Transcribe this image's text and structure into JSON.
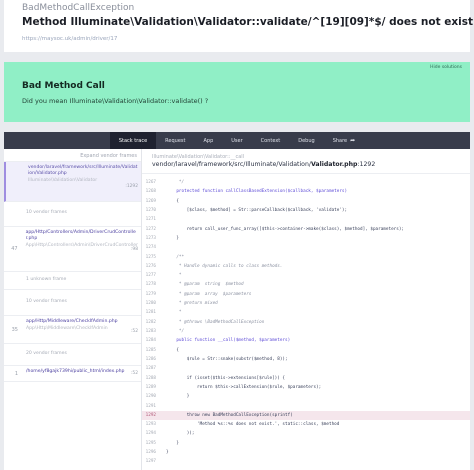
{
  "header": {
    "exception_class": "BadMethodCallException",
    "message": "Method Illuminate\\Validation\\Validator::validate/^[19][09]*$/ does not exist.",
    "url": "https://maysoc.uk/admin/driver/17"
  },
  "solution": {
    "hide_label": "Hide solutions",
    "title": "Bad Method Call",
    "description": "Did you mean Illuminate\\Validation\\Validator::validate() ?"
  },
  "tabs": [
    {
      "label": "Stack trace"
    },
    {
      "label": "Request"
    },
    {
      "label": "App"
    },
    {
      "label": "User"
    },
    {
      "label": "Context"
    },
    {
      "label": "Debug"
    },
    {
      "label": "Share"
    }
  ],
  "stack": {
    "expand_label": "Expand vendor frames",
    "frames": [
      {
        "num": "",
        "file": "vendor/laravel/framework/src/Illuminate/Validation/Validator.php",
        "method": "",
        "line": ""
      },
      {
        "num": "61",
        "file": "Illuminate\\Validation\\Validator",
        "method": "",
        "line": ":1292"
      },
      {
        "num": "",
        "file": "10 vendor frames",
        "method": "",
        "line": ""
      },
      {
        "num": "",
        "file": "app/Http/Controllers/Admin/DriverCrudController.php",
        "method": "",
        "line": ""
      },
      {
        "num": "47",
        "file": "App\\Http\\Controllers\\Admin\\DriverCrudController",
        "method": "",
        "line": ":98"
      },
      {
        "num": "",
        "file": "1 unknown frame",
        "method": "",
        "line": ""
      },
      {
        "num": "",
        "file": "10 vendor frames",
        "method": "",
        "line": ""
      },
      {
        "num": "35",
        "file": "app/Http/Middleware/CheckIfAdmin.php",
        "method": "App\\Http\\Middleware\\CheckIfAdmin",
        "line": ":52"
      },
      {
        "num": "",
        "file": "20 vendor frames",
        "method": "",
        "line": ""
      },
      {
        "num": "1",
        "file": "/home/yf8gajk739hi/public_html/index.php",
        "method": "",
        "line": ":52"
      }
    ]
  },
  "code": {
    "method": "Illuminate\\Validation\\Validator::__call",
    "path_prefix": "vendor/laravel/framework/src/Illuminate/Validation/",
    "path_file": "Validator.php",
    "path_line": ":1292",
    "lines": [
      {
        "n": "1267",
        "t": "     */",
        "style": "cm"
      },
      {
        "n": "1268",
        "t": "    protected function callClassBasedExtension($callback, $parameters)",
        "style": "kw"
      },
      {
        "n": "1269",
        "t": "    {",
        "style": ""
      },
      {
        "n": "1270",
        "t": "        [$class, $method] = Str::parseCallback($callback, 'validate');",
        "style": ""
      },
      {
        "n": "1271",
        "t": "",
        "style": ""
      },
      {
        "n": "1272",
        "t": "        return call_user_func_array([$this->container->make($class), $method], $parameters);",
        "style": ""
      },
      {
        "n": "1273",
        "t": "    }",
        "style": ""
      },
      {
        "n": "1274",
        "t": "",
        "style": ""
      },
      {
        "n": "1275",
        "t": "    /**",
        "style": "cm"
      },
      {
        "n": "1276",
        "t": "     * Handle dynamic calls to class methods.",
        "style": "cm"
      },
      {
        "n": "1277",
        "t": "     *",
        "style": "cm"
      },
      {
        "n": "1278",
        "t": "     * @param  string  $method",
        "style": "cm"
      },
      {
        "n": "1279",
        "t": "     * @param  array  $parameters",
        "style": "cm"
      },
      {
        "n": "1280",
        "t": "     * @return mixed",
        "style": "cm"
      },
      {
        "n": "1281",
        "t": "     *",
        "style": "cm"
      },
      {
        "n": "1282",
        "t": "     * @throws \\BadMethodCallException",
        "style": "cm"
      },
      {
        "n": "1283",
        "t": "     */",
        "style": "cm"
      },
      {
        "n": "1284",
        "t": "    public function __call($method, $parameters)",
        "style": "kw"
      },
      {
        "n": "1285",
        "t": "    {",
        "style": ""
      },
      {
        "n": "1286",
        "t": "        $rule = Str::snake(substr($method, 8));",
        "style": ""
      },
      {
        "n": "1287",
        "t": "",
        "style": ""
      },
      {
        "n": "1288",
        "t": "        if (isset($this->extensions[$rule])) {",
        "style": ""
      },
      {
        "n": "1289",
        "t": "            return $this->callExtension($rule, $parameters);",
        "style": ""
      },
      {
        "n": "1290",
        "t": "        }",
        "style": ""
      },
      {
        "n": "1291",
        "t": "",
        "style": ""
      },
      {
        "n": "1292",
        "t": "        throw new BadMethodCallException(sprintf(",
        "style": "hl"
      },
      {
        "n": "1293",
        "t": "            'Method %s::%s does not exist.', static::class, $method",
        "style": ""
      },
      {
        "n": "1294",
        "t": "        ));",
        "style": ""
      },
      {
        "n": "1295",
        "t": "    }",
        "style": ""
      },
      {
        "n": "1296",
        "t": "}",
        "style": ""
      },
      {
        "n": "1297",
        "t": "",
        "style": ""
      }
    ]
  }
}
